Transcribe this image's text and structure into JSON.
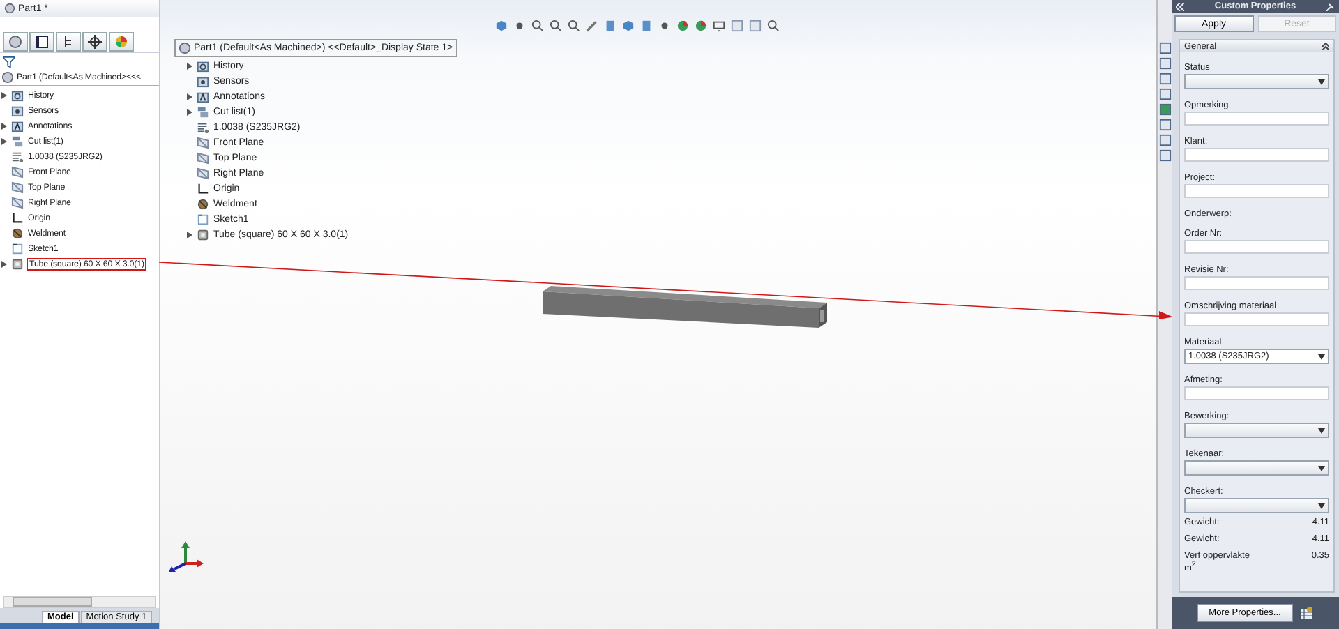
{
  "window": {
    "title": "Part1 *"
  },
  "feature_manager": {
    "root": "Part1  (Default<As Machined><<<",
    "items": [
      {
        "label": "History",
        "kind": "history",
        "collapsed": true,
        "highlighted": false
      },
      {
        "label": "Sensors",
        "kind": "sensors",
        "collapsed": false,
        "highlighted": false
      },
      {
        "label": "Annotations",
        "kind": "annotations",
        "collapsed": true,
        "highlighted": false
      },
      {
        "label": "Cut list(1)",
        "kind": "cutlist",
        "collapsed": true,
        "highlighted": false
      },
      {
        "label": "1.0038 (S235JRG2)",
        "kind": "material",
        "collapsed": false,
        "highlighted": false
      },
      {
        "label": "Front Plane",
        "kind": "plane",
        "collapsed": false,
        "highlighted": false
      },
      {
        "label": "Top Plane",
        "kind": "plane",
        "collapsed": false,
        "highlighted": false
      },
      {
        "label": "Right Plane",
        "kind": "plane",
        "collapsed": false,
        "highlighted": false
      },
      {
        "label": "Origin",
        "kind": "origin",
        "collapsed": false,
        "highlighted": false
      },
      {
        "label": "Weldment",
        "kind": "weldment",
        "collapsed": false,
        "highlighted": false
      },
      {
        "label": "Sketch1",
        "kind": "sketch",
        "collapsed": false,
        "highlighted": false
      },
      {
        "label": "Tube (square) 60 X 60 X 3.0(1)",
        "kind": "body",
        "collapsed": true,
        "highlighted": true
      }
    ],
    "bottom_tabs": [
      {
        "label": "Model",
        "selected": true
      },
      {
        "label": "Motion Study 1",
        "selected": false
      }
    ]
  },
  "flyout_tree": {
    "root": "Part1  (Default<As Machined>) <<Default>_Display State 1>",
    "items": [
      {
        "label": "History",
        "kind": "history",
        "collapsed": true
      },
      {
        "label": "Sensors",
        "kind": "sensors",
        "collapsed": false
      },
      {
        "label": "Annotations",
        "kind": "annotations",
        "collapsed": true
      },
      {
        "label": "Cut list(1)",
        "kind": "cutlist",
        "collapsed": true
      },
      {
        "label": "1.0038 (S235JRG2)",
        "kind": "material",
        "collapsed": false
      },
      {
        "label": "Front Plane",
        "kind": "plane",
        "collapsed": false
      },
      {
        "label": "Top Plane",
        "kind": "plane",
        "collapsed": false
      },
      {
        "label": "Right Plane",
        "kind": "plane",
        "collapsed": false
      },
      {
        "label": "Origin",
        "kind": "origin",
        "collapsed": false
      },
      {
        "label": "Weldment",
        "kind": "weldment",
        "collapsed": false
      },
      {
        "label": "Sketch1",
        "kind": "sketch",
        "collapsed": false
      },
      {
        "label": "Tube (square) 60 X 60 X 3.0(1)",
        "kind": "body",
        "collapsed": true
      }
    ]
  },
  "custom_properties": {
    "title": "Custom Properties",
    "buttons": [
      {
        "label": "Apply",
        "disabled": false
      },
      {
        "label": "Reset",
        "disabled": true
      }
    ],
    "group": "General",
    "fields": [
      {
        "kind": "dropdown",
        "label": "Status"
      },
      {
        "kind": "text",
        "label": "Opmerking"
      },
      {
        "kind": "text",
        "label": "Klant:"
      },
      {
        "kind": "text",
        "label": "Project:"
      },
      {
        "kind": "label",
        "label": "Onderwerp:"
      },
      {
        "kind": "text",
        "label": "Order Nr:"
      },
      {
        "kind": "text",
        "label": "Revisie Nr:"
      },
      {
        "kind": "text",
        "label": "Omschrijving materiaal"
      },
      {
        "kind": "dropdown",
        "label": "Materiaal",
        "value": "1.0038 (S235JRG2)"
      },
      {
        "kind": "text",
        "label": "Afmeting:"
      },
      {
        "kind": "dropdown",
        "label": "Bewerking:"
      },
      {
        "kind": "dropdown",
        "label": "Tekenaar:"
      },
      {
        "kind": "dropdown",
        "label": "Checkert:"
      },
      {
        "kind": "readout",
        "label": "Gewicht:",
        "value": "4.11"
      },
      {
        "kind": "readout",
        "label": "Gewicht:",
        "value": "4.11"
      },
      {
        "kind": "readout",
        "label": "Verf oppervlakte m$^{2}$",
        "value": "0.35"
      }
    ],
    "more_button": "More Properties..."
  }
}
